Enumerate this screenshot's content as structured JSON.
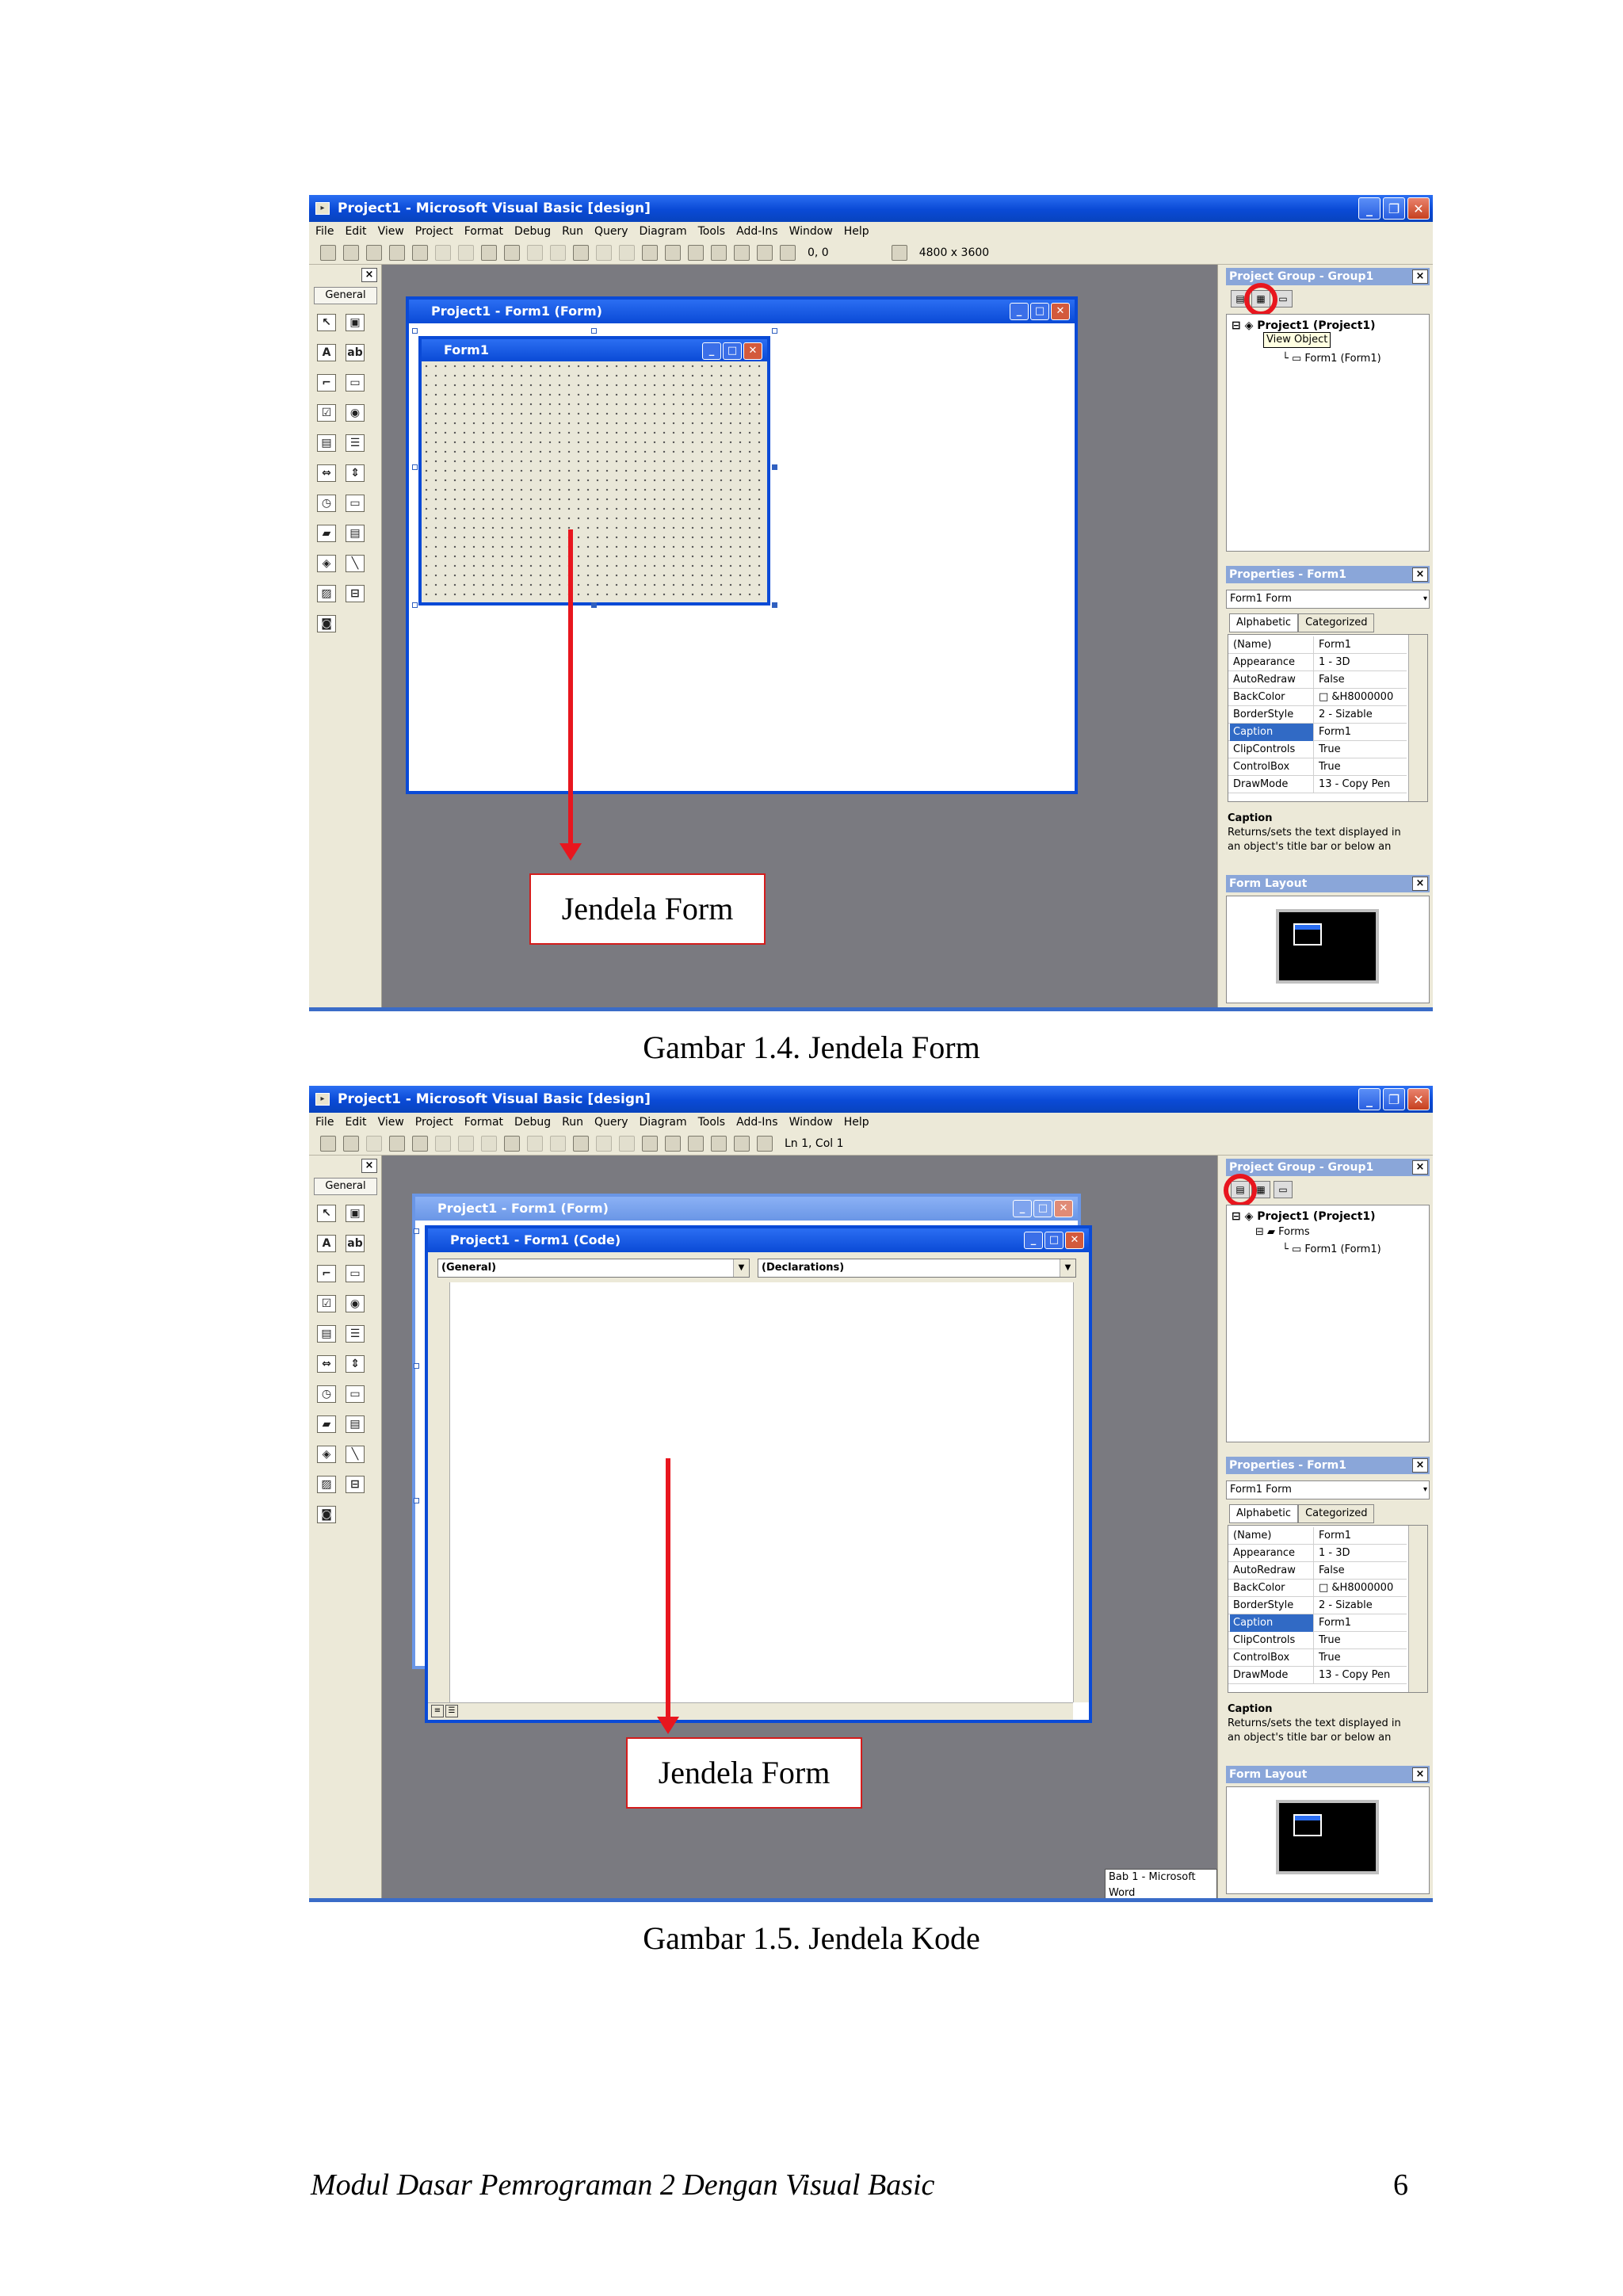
{
  "app": {
    "window_title": "Project1 - Microsoft Visual Basic [design]",
    "menus": [
      "File",
      "Edit",
      "View",
      "Project",
      "Format",
      "Debug",
      "Run",
      "Query",
      "Diagram",
      "Tools",
      "Add-Ins",
      "Window",
      "Help"
    ],
    "toolbox_header": "General"
  },
  "figure1": {
    "coords": "0, 0",
    "size": "4800 x 3600",
    "form_window_title": "Project1 - Form1 (Form)",
    "inner_form_title": "Form1",
    "project_group_title": "Project Group - Group1",
    "tree": {
      "project": "Project1 (Project1)",
      "tooltip": "View Object",
      "form": "Form1 (Form1)"
    },
    "callout": "Jendela Form",
    "caption": "Gambar 1.4. Jendela Form"
  },
  "figure2": {
    "status": "Ln 1, Col 1",
    "form_window_title": "Project1 - Form1 (Form)",
    "code_window_title": "Project1 - Form1 (Code)",
    "combo_left": "(General)",
    "combo_right": "(Declarations)",
    "project_group_title": "Project Group - Group1",
    "tree": {
      "project": "Project1 (Project1)",
      "folder": "Forms",
      "form": "Form1 (Form1)"
    },
    "taskbar_hint": "Bab 1 - Microsoft Word",
    "callout": "Jendela Form",
    "caption": "Gambar 1.5. Jendela Kode"
  },
  "properties": {
    "title": "Properties - Form1",
    "object": "Form1 Form",
    "tabs": [
      "Alphabetic",
      "Categorized"
    ],
    "rows": [
      {
        "name": "(Name)",
        "value": "Form1"
      },
      {
        "name": "Appearance",
        "value": "1 - 3D"
      },
      {
        "name": "AutoRedraw",
        "value": "False"
      },
      {
        "name": "BackColor",
        "value": "□ &H8000000"
      },
      {
        "name": "BorderStyle",
        "value": "2 - Sizable"
      },
      {
        "name": "Caption",
        "value": "Form1"
      },
      {
        "name": "ClipControls",
        "value": "True"
      },
      {
        "name": "ControlBox",
        "value": "True"
      },
      {
        "name": "DrawMode",
        "value": "13 - Copy Pen"
      }
    ],
    "desc_title": "Caption",
    "desc_line1": "Returns/sets the text displayed in",
    "desc_line2": "an object's title bar or below an",
    "layout_title": "Form Layout"
  },
  "footer": {
    "title": "Modul Dasar Pemrograman 2 Dengan Visual Basic",
    "page_number": "6"
  },
  "colors": {
    "titlebar": "#0a4ad6",
    "workspace": "#7a7a80",
    "annotation": "#e8161e"
  }
}
